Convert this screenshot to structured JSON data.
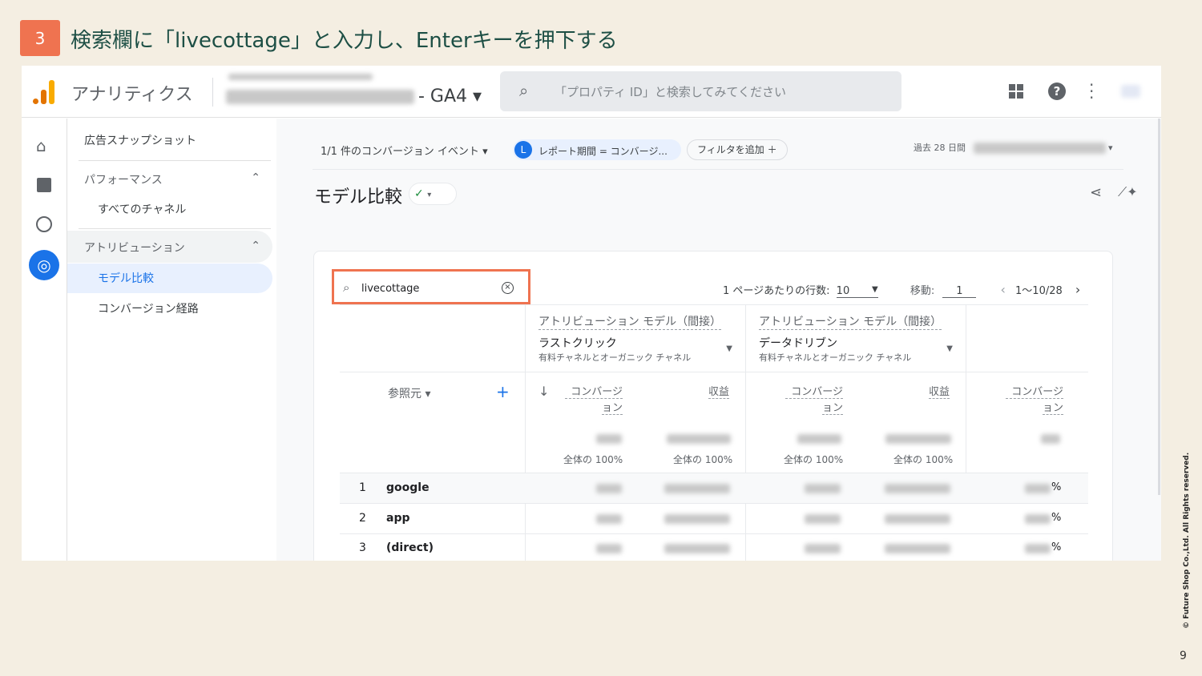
{
  "slide": {
    "step": "3",
    "title": "検索欄に「livecottage」と入力し、Enterキーを押下する",
    "copyright": "© Future Shop Co.,Ltd. All Rights reserved.",
    "page": "9"
  },
  "topbar": {
    "app": "アナリティクス",
    "property_suffix": "- GA4",
    "search_placeholder": "「プロパティ ID」と検索してみてください"
  },
  "sidebar": {
    "snapshot": "広告スナップショット",
    "performance": "パフォーマンス",
    "all_channels": "すべてのチャネル",
    "attribution": "アトリビューション",
    "model_compare": "モデル比較",
    "conversion_paths": "コンバージョン経路"
  },
  "filters": {
    "events": "1/1 件のコンバージョン イベント",
    "chip_letter": "L",
    "chip": "レポート期間 = コンバージ...",
    "add_filter": "フィルタを追加",
    "date_label": "過去 28 日間"
  },
  "page_title": "モデル比較",
  "table": {
    "search_value": "livecottage",
    "rows_per_page_label": "1 ページあたりの行数:",
    "rows_per_page": "10",
    "goto_label": "移動:",
    "goto_value": "1",
    "range": "1〜10/28",
    "model_label": "アトリビューション モデル（間接）",
    "model1": "ラストクリック",
    "model2": "データドリブン",
    "channel_scope": "有料チャネルとオーガニック チャネル",
    "dimension": "参照元",
    "col_conv1": "コンバージ",
    "col_conv2": "ョン",
    "col_revenue": "収益",
    "total_pct": "全体の 100%",
    "rows": [
      {
        "n": "1",
        "name": "google"
      },
      {
        "n": "2",
        "name": "app"
      },
      {
        "n": "3",
        "name": "(direct)"
      }
    ],
    "pct_suffix": "%"
  },
  "colors": {
    "accent": "#1a73e8",
    "highlight": "#ef7350",
    "green": "#1e8e3e"
  }
}
